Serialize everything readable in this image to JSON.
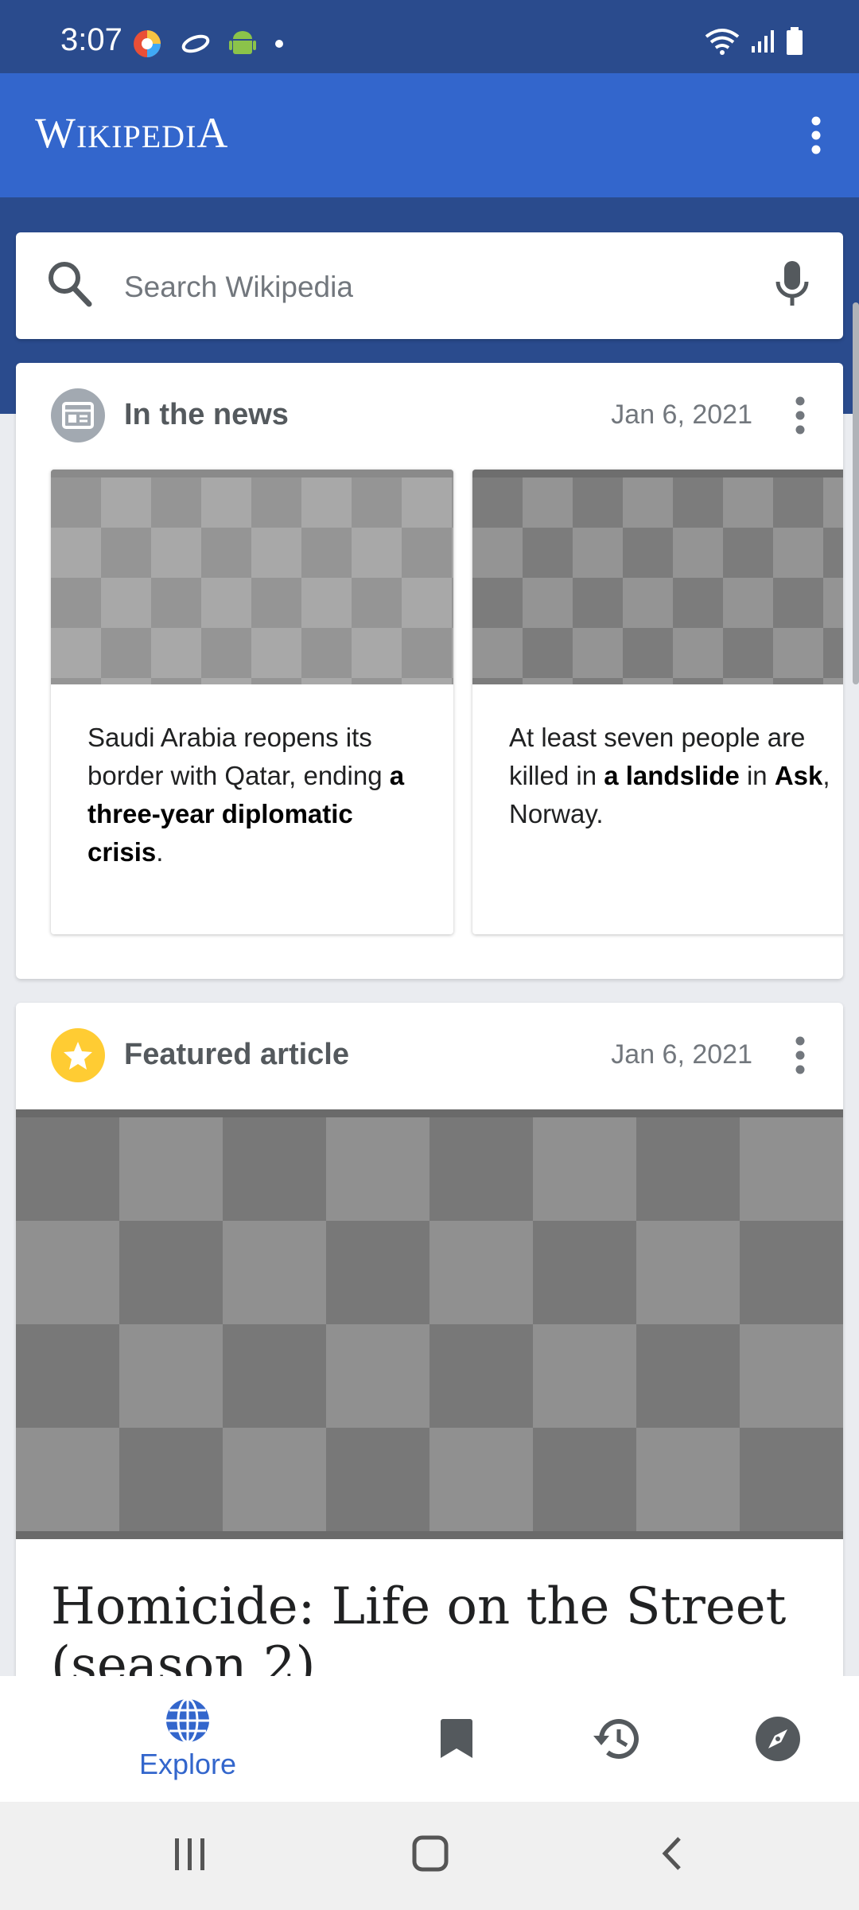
{
  "status_bar": {
    "time": "3:07",
    "left_icons": [
      "app-notification-icon",
      "link-icon",
      "android-icon",
      "dot-icon"
    ],
    "right_icons": [
      "wifi-icon",
      "signal-icon",
      "battery-icon"
    ]
  },
  "app_bar": {
    "title_first": "W",
    "title_rest": "IKIPEDI",
    "title_last": "A",
    "menu_icon": "more-vert-icon"
  },
  "search": {
    "placeholder": "Search Wikipedia",
    "icon": "search-icon",
    "voice_icon": "mic-icon"
  },
  "news_card": {
    "title": "In the news",
    "date": "Jan 6, 2021",
    "icon": "newspaper-icon",
    "items": [
      {
        "pre": "Saudi Arabia reopens its border with Qatar, ending ",
        "bold": "a three-year diplomatic crisis",
        "post": "."
      },
      {
        "pre": "At least seven people are killed in ",
        "bold": "a landslide",
        "mid": " in ",
        "bold2": "Ask",
        "post": ", Norway."
      }
    ]
  },
  "featured_card": {
    "title": "Featured article",
    "date": "Jan 6, 2021",
    "icon": "star-icon",
    "article_title": "Homicide: Life on the Street (season 2)"
  },
  "bottom_nav": {
    "items": [
      {
        "label": "Explore",
        "icon": "globe-icon",
        "active": true
      },
      {
        "label": "",
        "icon": "bookmark-icon",
        "active": false
      },
      {
        "label": "",
        "icon": "history-icon",
        "active": false
      },
      {
        "label": "",
        "icon": "compass-icon",
        "active": false
      }
    ]
  },
  "colors": {
    "brand": "#3366cc",
    "brand_dark": "#2a4b8d",
    "featured_star": "#ffcc33"
  }
}
